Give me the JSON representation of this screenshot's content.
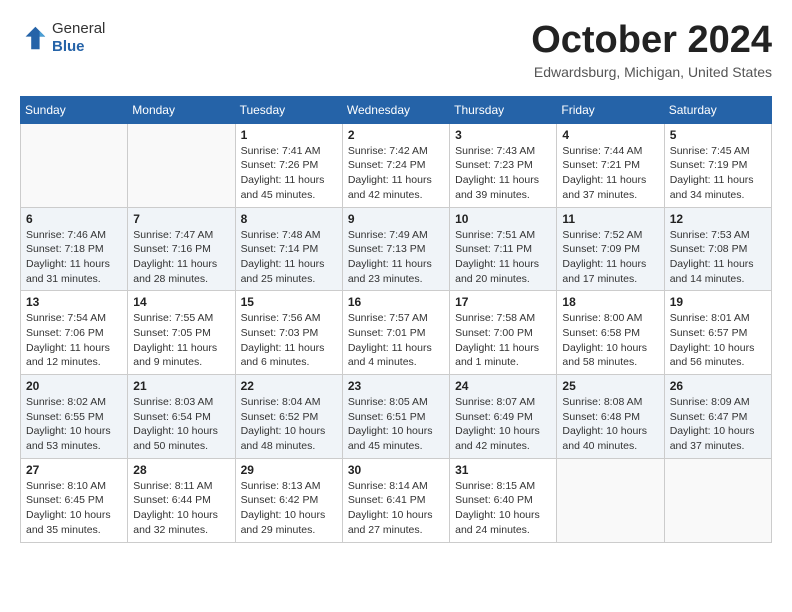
{
  "header": {
    "logo": {
      "general": "General",
      "blue": "Blue"
    },
    "title": "October 2024",
    "location": "Edwardsburg, Michigan, United States"
  },
  "weekdays": [
    "Sunday",
    "Monday",
    "Tuesday",
    "Wednesday",
    "Thursday",
    "Friday",
    "Saturday"
  ],
  "weeks": [
    [
      {
        "day": "",
        "info": ""
      },
      {
        "day": "",
        "info": ""
      },
      {
        "day": "1",
        "info": "Sunrise: 7:41 AM\nSunset: 7:26 PM\nDaylight: 11 hours and 45 minutes."
      },
      {
        "day": "2",
        "info": "Sunrise: 7:42 AM\nSunset: 7:24 PM\nDaylight: 11 hours and 42 minutes."
      },
      {
        "day": "3",
        "info": "Sunrise: 7:43 AM\nSunset: 7:23 PM\nDaylight: 11 hours and 39 minutes."
      },
      {
        "day": "4",
        "info": "Sunrise: 7:44 AM\nSunset: 7:21 PM\nDaylight: 11 hours and 37 minutes."
      },
      {
        "day": "5",
        "info": "Sunrise: 7:45 AM\nSunset: 7:19 PM\nDaylight: 11 hours and 34 minutes."
      }
    ],
    [
      {
        "day": "6",
        "info": "Sunrise: 7:46 AM\nSunset: 7:18 PM\nDaylight: 11 hours and 31 minutes."
      },
      {
        "day": "7",
        "info": "Sunrise: 7:47 AM\nSunset: 7:16 PM\nDaylight: 11 hours and 28 minutes."
      },
      {
        "day": "8",
        "info": "Sunrise: 7:48 AM\nSunset: 7:14 PM\nDaylight: 11 hours and 25 minutes."
      },
      {
        "day": "9",
        "info": "Sunrise: 7:49 AM\nSunset: 7:13 PM\nDaylight: 11 hours and 23 minutes."
      },
      {
        "day": "10",
        "info": "Sunrise: 7:51 AM\nSunset: 7:11 PM\nDaylight: 11 hours and 20 minutes."
      },
      {
        "day": "11",
        "info": "Sunrise: 7:52 AM\nSunset: 7:09 PM\nDaylight: 11 hours and 17 minutes."
      },
      {
        "day": "12",
        "info": "Sunrise: 7:53 AM\nSunset: 7:08 PM\nDaylight: 11 hours and 14 minutes."
      }
    ],
    [
      {
        "day": "13",
        "info": "Sunrise: 7:54 AM\nSunset: 7:06 PM\nDaylight: 11 hours and 12 minutes."
      },
      {
        "day": "14",
        "info": "Sunrise: 7:55 AM\nSunset: 7:05 PM\nDaylight: 11 hours and 9 minutes."
      },
      {
        "day": "15",
        "info": "Sunrise: 7:56 AM\nSunset: 7:03 PM\nDaylight: 11 hours and 6 minutes."
      },
      {
        "day": "16",
        "info": "Sunrise: 7:57 AM\nSunset: 7:01 PM\nDaylight: 11 hours and 4 minutes."
      },
      {
        "day": "17",
        "info": "Sunrise: 7:58 AM\nSunset: 7:00 PM\nDaylight: 11 hours and 1 minute."
      },
      {
        "day": "18",
        "info": "Sunrise: 8:00 AM\nSunset: 6:58 PM\nDaylight: 10 hours and 58 minutes."
      },
      {
        "day": "19",
        "info": "Sunrise: 8:01 AM\nSunset: 6:57 PM\nDaylight: 10 hours and 56 minutes."
      }
    ],
    [
      {
        "day": "20",
        "info": "Sunrise: 8:02 AM\nSunset: 6:55 PM\nDaylight: 10 hours and 53 minutes."
      },
      {
        "day": "21",
        "info": "Sunrise: 8:03 AM\nSunset: 6:54 PM\nDaylight: 10 hours and 50 minutes."
      },
      {
        "day": "22",
        "info": "Sunrise: 8:04 AM\nSunset: 6:52 PM\nDaylight: 10 hours and 48 minutes."
      },
      {
        "day": "23",
        "info": "Sunrise: 8:05 AM\nSunset: 6:51 PM\nDaylight: 10 hours and 45 minutes."
      },
      {
        "day": "24",
        "info": "Sunrise: 8:07 AM\nSunset: 6:49 PM\nDaylight: 10 hours and 42 minutes."
      },
      {
        "day": "25",
        "info": "Sunrise: 8:08 AM\nSunset: 6:48 PM\nDaylight: 10 hours and 40 minutes."
      },
      {
        "day": "26",
        "info": "Sunrise: 8:09 AM\nSunset: 6:47 PM\nDaylight: 10 hours and 37 minutes."
      }
    ],
    [
      {
        "day": "27",
        "info": "Sunrise: 8:10 AM\nSunset: 6:45 PM\nDaylight: 10 hours and 35 minutes."
      },
      {
        "day": "28",
        "info": "Sunrise: 8:11 AM\nSunset: 6:44 PM\nDaylight: 10 hours and 32 minutes."
      },
      {
        "day": "29",
        "info": "Sunrise: 8:13 AM\nSunset: 6:42 PM\nDaylight: 10 hours and 29 minutes."
      },
      {
        "day": "30",
        "info": "Sunrise: 8:14 AM\nSunset: 6:41 PM\nDaylight: 10 hours and 27 minutes."
      },
      {
        "day": "31",
        "info": "Sunrise: 8:15 AM\nSunset: 6:40 PM\nDaylight: 10 hours and 24 minutes."
      },
      {
        "day": "",
        "info": ""
      },
      {
        "day": "",
        "info": ""
      }
    ]
  ]
}
